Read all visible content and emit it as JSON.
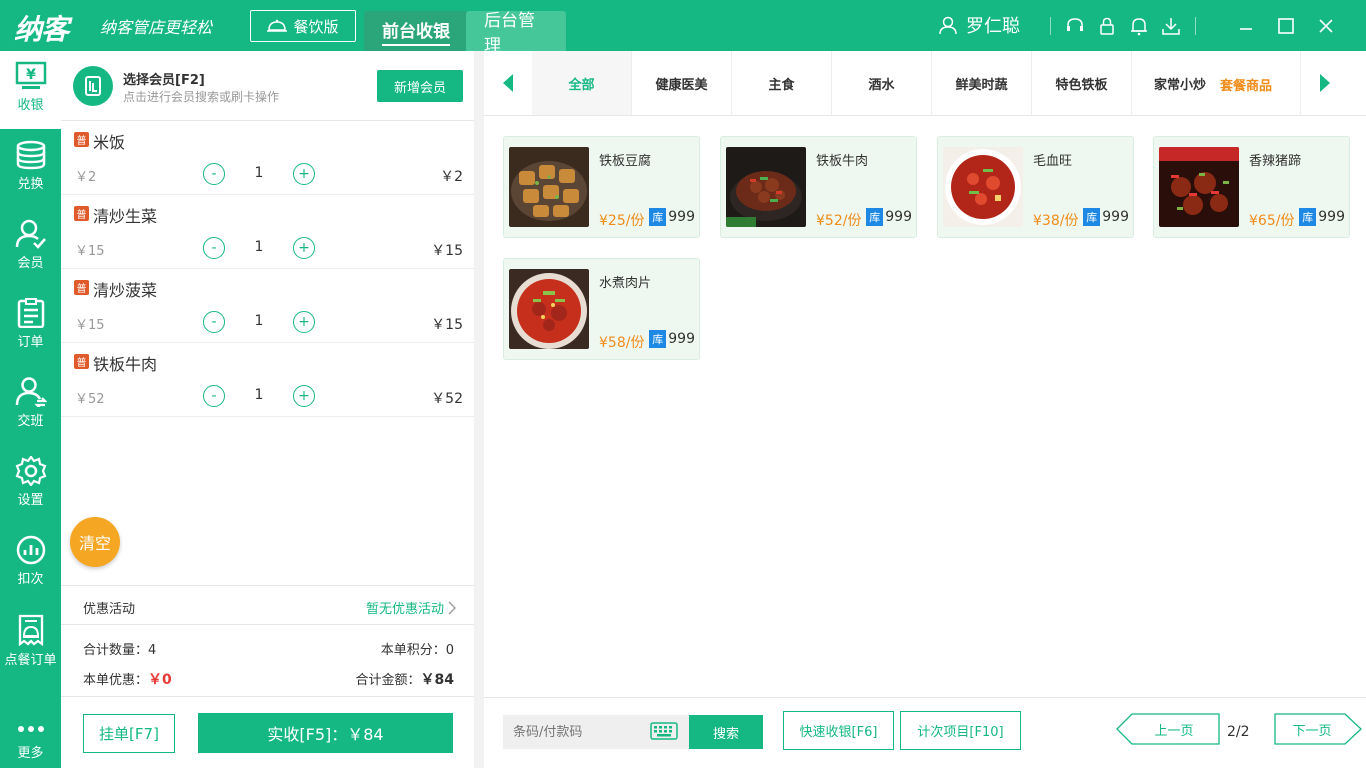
{
  "header": {
    "logo": "纳客",
    "slogan": "纳客管店更轻松",
    "edition": "餐饮版",
    "tabs": [
      {
        "label": "前台收银"
      },
      {
        "label": "后台管理"
      }
    ],
    "user": "罗仁聪"
  },
  "sidebar": {
    "items": [
      {
        "label": "收银"
      },
      {
        "label": "兑换"
      },
      {
        "label": "会员"
      },
      {
        "label": "订单"
      },
      {
        "label": "交班"
      },
      {
        "label": "设置"
      },
      {
        "label": "扣次"
      },
      {
        "label": "点餐订单"
      },
      {
        "label": "更多"
      }
    ]
  },
  "member": {
    "title": "选择会员[F2]",
    "subtitle": "点击进行会员搜索或刷卡操作",
    "add_label": "新增会员"
  },
  "order": {
    "badge": "普",
    "items": [
      {
        "name": "米饭",
        "unit_price": "￥2",
        "qty": "1",
        "total": "￥2"
      },
      {
        "name": "清炒生菜",
        "unit_price": "￥15",
        "qty": "1",
        "total": "￥15"
      },
      {
        "name": "清炒菠菜",
        "unit_price": "￥15",
        "qty": "1",
        "total": "￥15"
      },
      {
        "name": "铁板牛肉",
        "unit_price": "￥52",
        "qty": "1",
        "total": "￥52"
      }
    ],
    "minus": "-",
    "plus": "+",
    "clear_label": "清空"
  },
  "promo": {
    "label": "优惠活动",
    "value": "暂无优惠活动"
  },
  "summary": {
    "count_label": "合计数量：",
    "count": "4",
    "points_label": "本单积分：",
    "points": "0",
    "discount_label": "本单优惠：",
    "discount": "￥0",
    "amount_label": "合计金额：",
    "amount": "￥84"
  },
  "actions": {
    "hold": "挂单[F7]",
    "pay": "实收[F5]：￥84"
  },
  "categories": {
    "items": [
      "全部",
      "健康医美",
      "主食",
      "酒水",
      "鲜美时蔬",
      "特色铁板",
      "家常小炒"
    ],
    "special": "套餐商品"
  },
  "products": [
    {
      "name": "铁板豆腐",
      "price": "¥25/份",
      "stock_tag": "库",
      "stock": "999"
    },
    {
      "name": "铁板牛肉",
      "price": "¥52/份",
      "stock_tag": "库",
      "stock": "999"
    },
    {
      "name": "毛血旺",
      "price": "¥38/份",
      "stock_tag": "库",
      "stock": "999"
    },
    {
      "name": "香辣猪蹄",
      "price": "¥65/份",
      "stock_tag": "库",
      "stock": "999"
    },
    {
      "name": "水煮肉片",
      "price": "¥58/份",
      "stock_tag": "库",
      "stock": "999"
    }
  ],
  "bottom": {
    "scan_placeholder": "条码/付款码",
    "search": "搜索",
    "quick_checkout": "快速收银[F6]",
    "count_items": "计次项目[F10]",
    "prev": "上一页",
    "page": "2/2",
    "next": "下一页"
  },
  "colors": {
    "primary": "#15b883",
    "accent_orange": "#f08c1a",
    "badge_red": "#e05a2b",
    "stock_blue": "#1e88e5",
    "clear_yellow": "#f5a623"
  }
}
